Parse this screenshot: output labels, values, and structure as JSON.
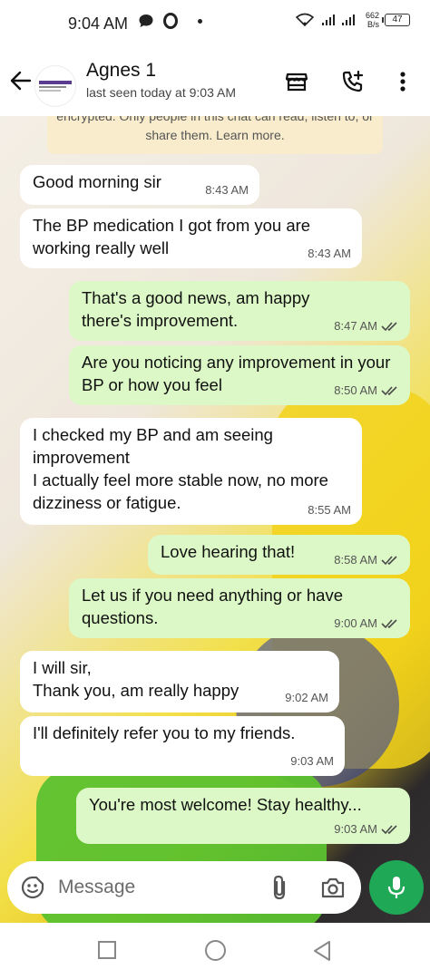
{
  "status_bar": {
    "time": "9:04 AM",
    "speed_value": "662",
    "speed_unit": "B/s",
    "battery": "47"
  },
  "header": {
    "contact_name": "Agnes 1",
    "last_seen": "last seen today at 9:03 AM"
  },
  "encryption_note": "encrypted. Only people in this chat can read, listen to, or share them. Learn more.",
  "messages": [
    {
      "direction": "in",
      "text": "Good morning sir",
      "time": "8:43 AM"
    },
    {
      "direction": "in",
      "text": "The BP medication I got from you are working really well",
      "time": "8:43 AM"
    },
    {
      "direction": "out",
      "text": "That's a good news, am happy there's improvement.",
      "time": "8:47 AM"
    },
    {
      "direction": "out",
      "text": "Are you noticing any improvement in your BP or how you feel",
      "time": "8:50 AM"
    },
    {
      "direction": "in",
      "text": "I checked my BP and am seeing improvement\nI actually feel more stable now, no more dizziness or fatigue.",
      "time": "8:55 AM"
    },
    {
      "direction": "out",
      "text": "Love hearing that!",
      "time": "8:58 AM"
    },
    {
      "direction": "out",
      "text": "Let us if you need anything or have questions.",
      "time": "9:00 AM"
    },
    {
      "direction": "in",
      "text": "I will sir,\nThank you, am really happy",
      "time": "9:02 AM"
    },
    {
      "direction": "in",
      "text": "I'll definitely refer you to my friends.",
      "time": "9:03 AM"
    },
    {
      "direction": "out",
      "text": "You're most welcome! Stay healthy...",
      "time": "9:03 AM"
    }
  ],
  "input": {
    "placeholder": "Message"
  },
  "colors": {
    "outgoing_bubble": "#dcf8c6",
    "incoming_bubble": "#ffffff",
    "mic_button": "#1fa855",
    "read_ticks": "#4a4a4a"
  },
  "icons": {
    "back": "back-arrow-icon",
    "store": "store-icon",
    "call": "add-call-icon",
    "menu": "more-vert-icon",
    "emoji": "emoji-icon",
    "attach": "paperclip-icon",
    "camera": "camera-icon",
    "mic": "mic-icon"
  }
}
